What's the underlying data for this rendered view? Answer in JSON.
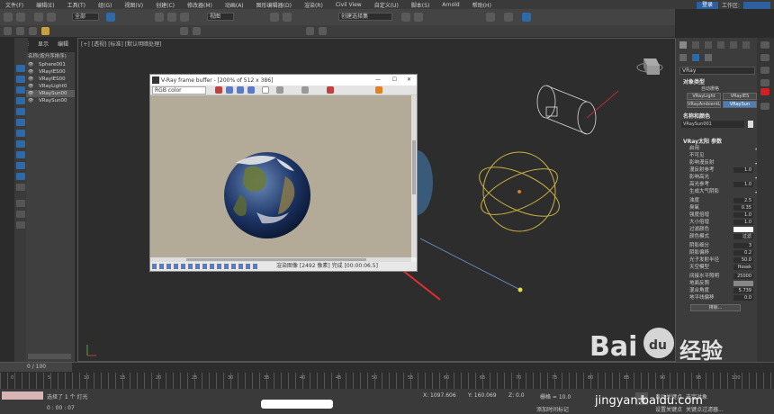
{
  "menubar": {
    "items": [
      "文件(F)",
      "编辑(E)",
      "工具(T)",
      "组(G)",
      "视图(V)",
      "创建(C)",
      "修改器(M)",
      "动画(A)",
      "图形编辑器(D)",
      "渲染(R)",
      "Civil View",
      "自定义(U)",
      "脚本(S)",
      "Arnold",
      "帮助(H)"
    ],
    "login": "登录",
    "workspace_label": "工作区:"
  },
  "toolbar": {
    "filter_combo": "全部",
    "view_combo": "视图",
    "selset_combo": "创建选择集"
  },
  "tabs": [
    "选择",
    "显示",
    "编辑"
  ],
  "viewport": {
    "label": "[+] [透视] [标准] [默认明暗处理]"
  },
  "explorer": {
    "header": "名称(按升序排序)",
    "items": [
      "Sphere001",
      "VRayIES00",
      "VRayIES00",
      "VRayLight0",
      "VRaySun00",
      "VRaySun00"
    ]
  },
  "vfb": {
    "title": "V-Ray frame buffer - [200% of 512 x 386]",
    "channel": "RGB color",
    "status": "渲染图像 [2492 像素] 完成 [00:00:06.5]"
  },
  "cmdpanel": {
    "top_label": "VRay",
    "object_type_title": "对象类型",
    "autogrid": "自动栅格",
    "buttons": [
      "VRayLight",
      "VRayIES",
      "VRayAmbientLight",
      "VRaySun"
    ],
    "name_color_title": "名称和颜色",
    "name_value": "VRaySun001",
    "sun_params_title": "VRay太阳 参数",
    "props": [
      {
        "label": "启用",
        "value": "✔"
      },
      {
        "label": "不可见",
        "value": ""
      },
      {
        "label": "影响漫反射",
        "value": "✔"
      },
      {
        "label": "漫反射参考",
        "value": "1.0"
      },
      {
        "label": "影响高光",
        "value": "✔"
      },
      {
        "label": "高光参考",
        "value": "1.0"
      },
      {
        "label": "生成大气阴影",
        "value": "✔"
      },
      {
        "label": "浊度",
        "value": "2.5"
      },
      {
        "label": "臭氧",
        "value": "0.35"
      },
      {
        "label": "强度倍增",
        "value": "1.0"
      },
      {
        "label": "大小倍增",
        "value": "1.0"
      },
      {
        "label": "过滤颜色",
        "value": ""
      },
      {
        "label": "颜色模式",
        "value": "过滤"
      },
      {
        "label": "阴影细分",
        "value": "3"
      },
      {
        "label": "阴影偏移",
        "value": "0.2"
      },
      {
        "label": "光子发射半径",
        "value": "50.0"
      },
      {
        "label": "天空模型",
        "value": "Hosek"
      },
      {
        "label": "间接水平照明",
        "value": "25000"
      },
      {
        "label": "地面反照",
        "value": ""
      },
      {
        "label": "混合角度",
        "value": "5.739"
      },
      {
        "label": "地平线偏移",
        "value": "0.0"
      }
    ],
    "exclude_btn": "排除..."
  },
  "timeline": {
    "frame": "0 / 100",
    "ticks": [
      "0",
      "5",
      "10",
      "15",
      "20",
      "25",
      "30",
      "35",
      "40",
      "45",
      "50",
      "55",
      "60",
      "65",
      "70",
      "75",
      "80",
      "85",
      "90",
      "95",
      "100"
    ]
  },
  "statusbar": {
    "selected": "选择了 1 个 灯光",
    "time": "0 : 00 : 07",
    "coords": {
      "x": "X: 1097.606",
      "y": "Y: 160.069",
      "z": "Z: 0.0"
    },
    "grid": "栅格 = 10.0",
    "addtime": "添加时间标记",
    "autokey": "自动关键点",
    "setkey": "设置关键点",
    "selobj": "选定对象",
    "keyfilter": "关键点过滤器..."
  },
  "watermark": {
    "brand": "Bai",
    "du": "du",
    "jy": "经验",
    "url": "jingyan.baidu.com"
  },
  "colors": {
    "accent": "#2e6aa8",
    "arrow": "#e03030",
    "sun_gizmo": "#c8b040"
  }
}
